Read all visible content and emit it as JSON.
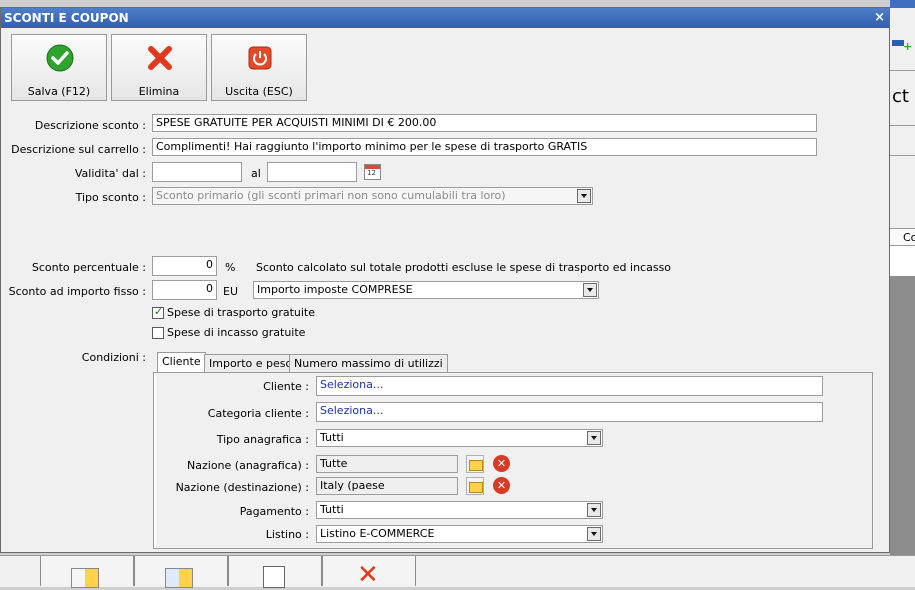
{
  "dialog": {
    "title": "SCONTI E COUPON",
    "close": "×"
  },
  "toolbar": {
    "save_label": "Salva (F12)",
    "delete_label": "Elimina",
    "exit_label": "Uscita (ESC)"
  },
  "form": {
    "descrizione_label": "Descrizione sconto :",
    "descrizione_value": "SPESE GRATUITE PER ACQUISTI MINIMI DI € 200.00",
    "carrello_label": "Descrizione sul carrello :",
    "carrello_value": "Complimenti! Hai raggiunto l'importo minimo per le spese di trasporto GRATIS",
    "validita_label": "Validita' dal :",
    "validita_from": "",
    "al_label": "al",
    "validita_to": "",
    "tipo_label": "Tipo sconto :",
    "tipo_value": "Sconto primario (gli sconti primari non sono cumulabili tra loro)",
    "perc_label": "Sconto percentuale :",
    "perc_value": "0",
    "perc_unit": "%",
    "perc_note": "Sconto calcolato sul totale prodotti escluse le spese di trasporto ed incasso",
    "fisso_label": "Sconto ad importo fisso :",
    "fisso_value": "0",
    "fisso_unit": "EU",
    "imposte_value": "Importo imposte COMPRESE",
    "trasporto_label": "Spese di trasporto gratuite",
    "trasporto_checked": true,
    "incasso_label": "Spese di incasso gratuite",
    "incasso_checked": false,
    "condizioni_label": "Condizioni :"
  },
  "tabs": [
    {
      "label": "Cliente",
      "active": true
    },
    {
      "label": "Importo e peso",
      "active": false
    },
    {
      "label": "Numero massimo di utilizzi",
      "active": false
    }
  ],
  "cliente_tab": {
    "cliente_label": "Cliente :",
    "cliente_value": "Seleziona...",
    "categoria_label": "Categoria cliente :",
    "categoria_value": "Seleziona...",
    "tipo_anag_label": "Tipo anagrafica :",
    "tipo_anag_value": "Tutti",
    "naz_anag_label": "Nazione (anagrafica) :",
    "naz_anag_value": "Tutte",
    "naz_dest_label": "Nazione (destinazione) :",
    "naz_dest_value": "Italy (paese",
    "pagamento_label": "Pagamento :",
    "pagamento_value": "Tutti",
    "listino_label": "Listino :",
    "listino_value": "Listino E-COMMERCE"
  },
  "background": {
    "partial_text_1": "ct",
    "partial_text_2": "Co"
  },
  "colors": {
    "title_bar": "#3f6fbe",
    "link_blue": "#1d2fa8",
    "save_green": "#2ea32e",
    "delete_red": "#e03a1e"
  }
}
